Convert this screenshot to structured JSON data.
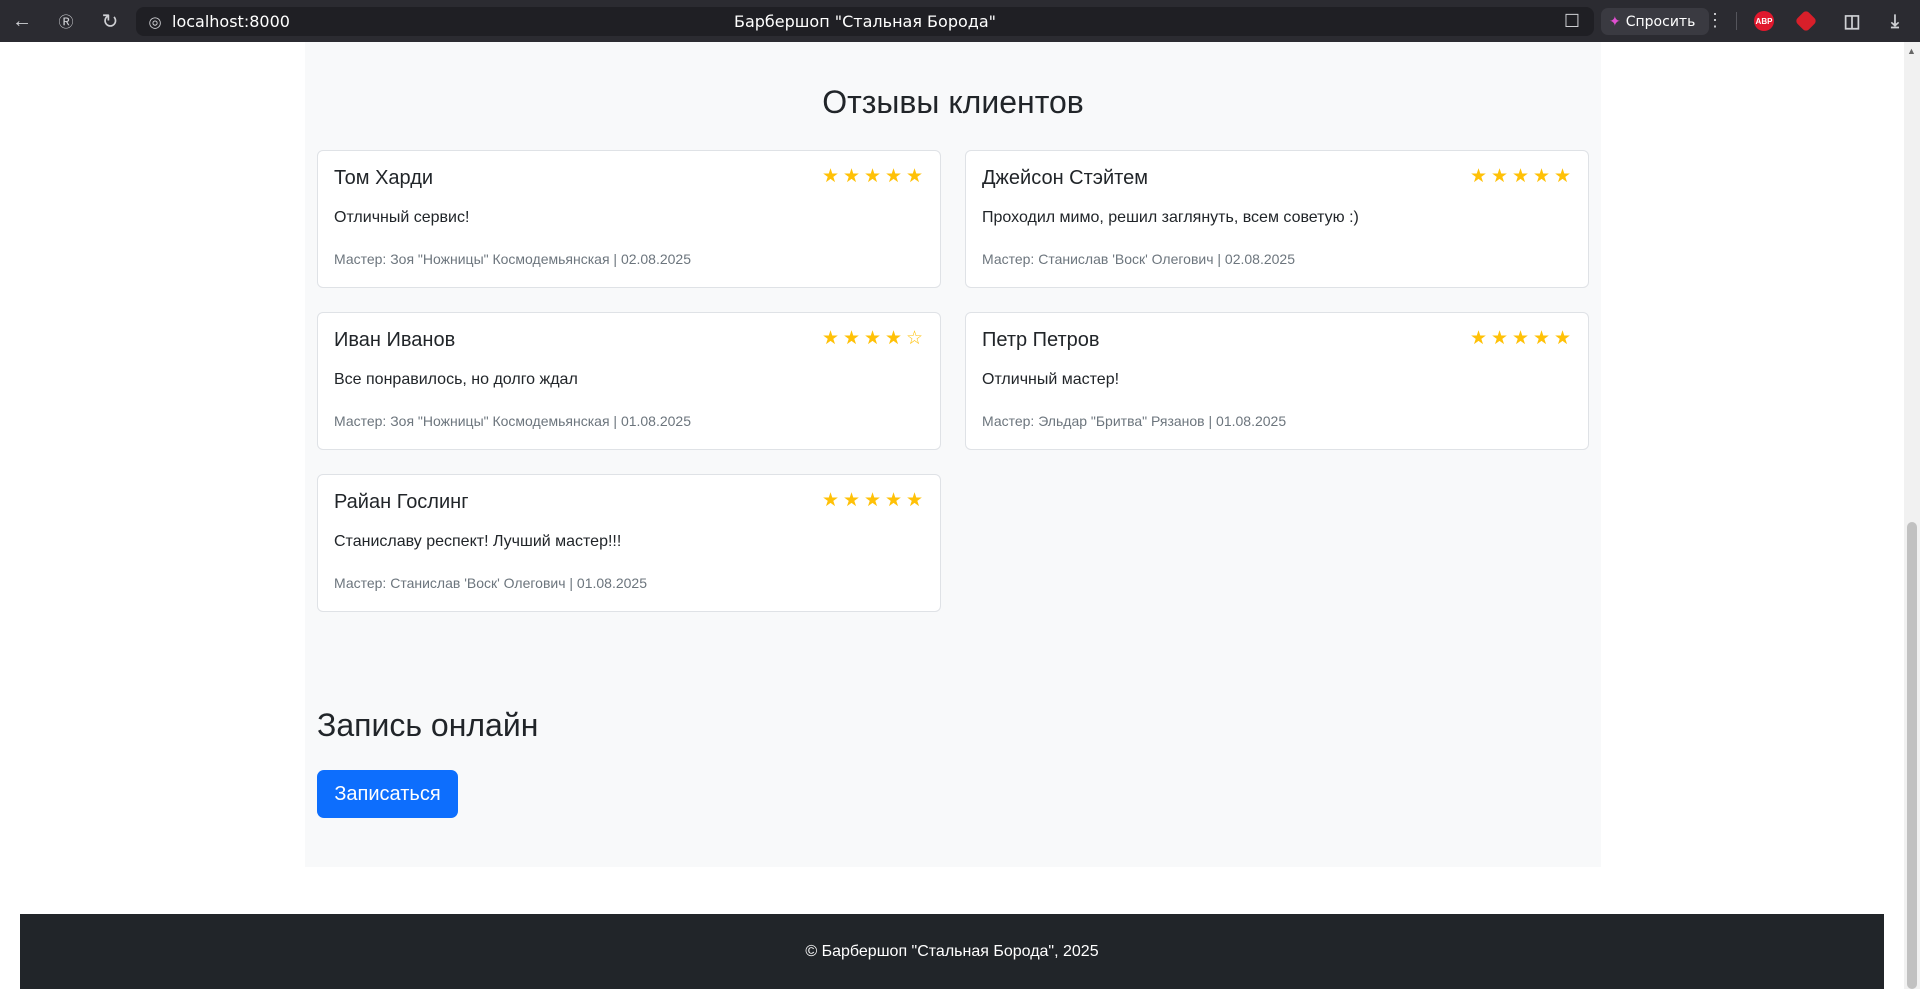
{
  "browser": {
    "url": "localhost:8000",
    "tab_title": "Барбершоп \"Стальная Борода\"",
    "ask_label": "Спросить",
    "abp_label": "ABP",
    "icons": [
      "back-icon",
      "yandex-icon",
      "reload-icon",
      "globe-icon",
      "bookmark-icon",
      "ask-icon",
      "menu-dots-icon",
      "adblock-icon",
      "extension-icon",
      "sidebar-icon",
      "download-icon"
    ]
  },
  "reviews": {
    "title": "Отзывы клиентов",
    "items": [
      {
        "name": "Том Харди",
        "rating": 5,
        "text": "Отличный сервис!",
        "meta": "Мастер: Зоя \"Ножницы\" Космодемьянская | 02.08.2025"
      },
      {
        "name": "Джейсон Стэйтем",
        "rating": 5,
        "text": "Проходил мимо, решил заглянуть, всем советую :)",
        "meta": "Мастер: Станислав 'Воск' Олегович | 02.08.2025"
      },
      {
        "name": "Иван Иванов",
        "rating": 4,
        "text": "Все понравилось, но долго ждал",
        "meta": "Мастер: Зоя \"Ножницы\" Космодемьянская | 01.08.2025"
      },
      {
        "name": "Петр Петров",
        "rating": 5,
        "text": "Отличный мастер!",
        "meta": "Мастер: Эльдар \"Бритва\" Рязанов | 01.08.2025"
      },
      {
        "name": "Райан Гослинг",
        "rating": 5,
        "text": "Станиславу респект! Лучший мастер!!!",
        "meta": "Мастер: Станислав 'Воск' Олегович | 01.08.2025"
      }
    ]
  },
  "booking": {
    "title": "Запись онлайн",
    "button_label": "Записаться"
  },
  "footer": {
    "text": "© Барбершоп \"Стальная Борода\", 2025"
  },
  "colors": {
    "star": "#ffc107",
    "primary": "#0d6efd",
    "footer_bg": "#212529",
    "section_bg": "#f8f9fa"
  }
}
